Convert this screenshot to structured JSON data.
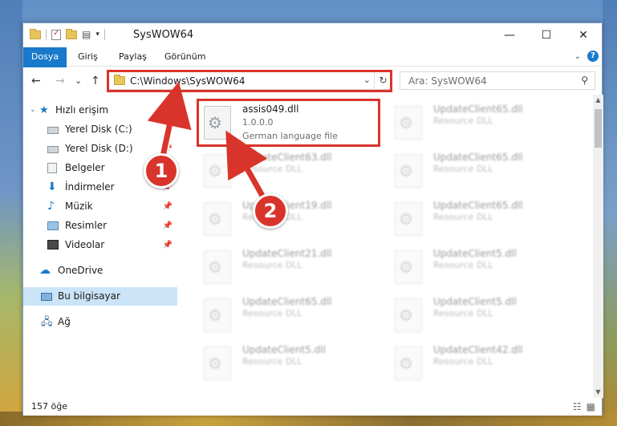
{
  "window": {
    "title": "SysWOW64",
    "controls": {
      "minimize": "—",
      "maximize": "☐",
      "close": "✕"
    }
  },
  "ribbon": {
    "tabs": [
      "Dosya",
      "Giriş",
      "Paylaş",
      "Görünüm"
    ],
    "help": "?"
  },
  "nav": {
    "back": "←",
    "forward": "→",
    "recent": "⌄",
    "up": "↑",
    "address": "C:\\Windows\\SysWOW64",
    "refresh": "↻",
    "search_placeholder": "Ara: SysWOW64"
  },
  "sidebar": {
    "quick_access": "Hızlı erişim",
    "items": [
      {
        "label": "Yerel Disk (C:)",
        "icon": "drive-icon"
      },
      {
        "label": "Yerel Disk (D:)",
        "icon": "drive-icon"
      },
      {
        "label": "Belgeler",
        "icon": "documents-icon"
      },
      {
        "label": "İndirmeler",
        "icon": "downloads-icon"
      },
      {
        "label": "Müzik",
        "icon": "music-icon"
      },
      {
        "label": "Resimler",
        "icon": "pictures-icon"
      },
      {
        "label": "Videolar",
        "icon": "videos-icon"
      }
    ],
    "onedrive": "OneDrive",
    "this_pc": "Bu bilgisayar",
    "network": "Ağ"
  },
  "files": {
    "highlighted": {
      "name": "assis049.dll",
      "version": "1.0.0.0",
      "description": "German language file"
    },
    "left_column": [
      {
        "name": "UpdateClient63.dll",
        "desc": "Resource DLL"
      },
      {
        "name": "UpdateClient19.dll",
        "desc": "Resource DLL"
      },
      {
        "name": "UpdateClient21.dll",
        "desc": "Resource DLL"
      },
      {
        "name": "UpdateClient65.dll",
        "desc": "Resource DLL"
      },
      {
        "name": "UpdateClient5.dll",
        "desc": "Resource DLL"
      }
    ],
    "right_column": [
      {
        "name": "UpdateClient65.dll",
        "desc": "Resource DLL"
      },
      {
        "name": "UpdateClient65.dll",
        "desc": "Resource DLL"
      },
      {
        "name": "UpdateClient65.dll",
        "desc": "Resource DLL"
      },
      {
        "name": "UpdateClient5.dll",
        "desc": "Resource DLL"
      },
      {
        "name": "UpdateClient5.dll",
        "desc": "Resource DLL"
      },
      {
        "name": "UpdateClient42.dll",
        "desc": "Resource DLL"
      }
    ]
  },
  "status": {
    "count": "157 öğe"
  },
  "annotations": {
    "step1": "1",
    "step2": "2"
  },
  "colors": {
    "accent": "#1979ca",
    "highlight": "#d9342b",
    "selected": "#cce4f7"
  }
}
